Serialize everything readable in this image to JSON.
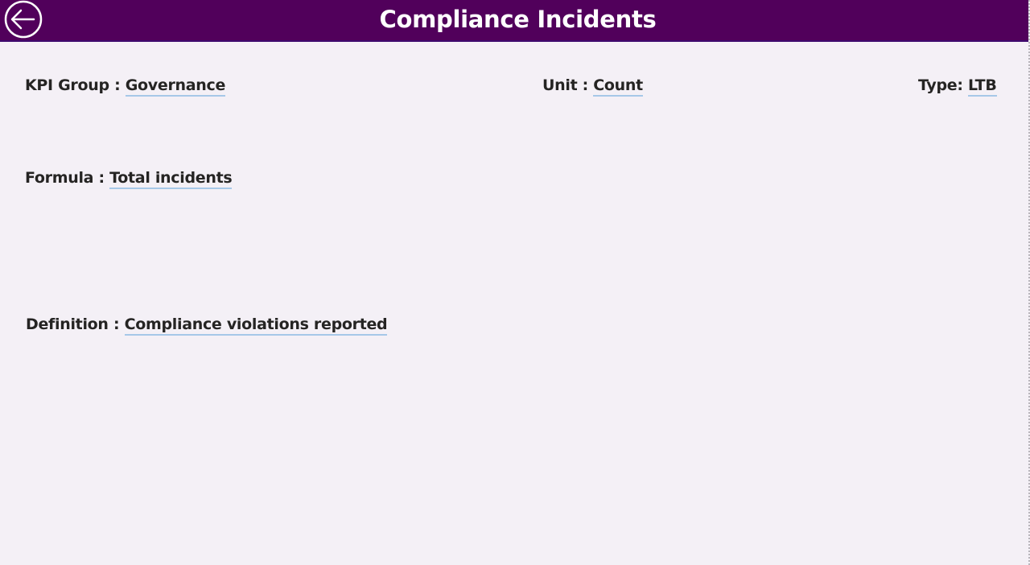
{
  "header": {
    "title": "Compliance Incidents",
    "back_icon": "arrow-left-circle-icon",
    "background_color": "#51005b"
  },
  "fields": {
    "kpi_group": {
      "label": "KPI Group : ",
      "value": "Governance"
    },
    "unit": {
      "label": "Unit : ",
      "value": "Count"
    },
    "type": {
      "label": "Type: ",
      "value": "LTB"
    },
    "formula": {
      "label": "Formula : ",
      "value": "Total incidents"
    },
    "definition": {
      "label": "Definition : ",
      "value": "Compliance violations reported"
    }
  },
  "colors": {
    "page_background": "#f4f0f6",
    "underline": "#a6c8e8",
    "text": "#252423"
  }
}
